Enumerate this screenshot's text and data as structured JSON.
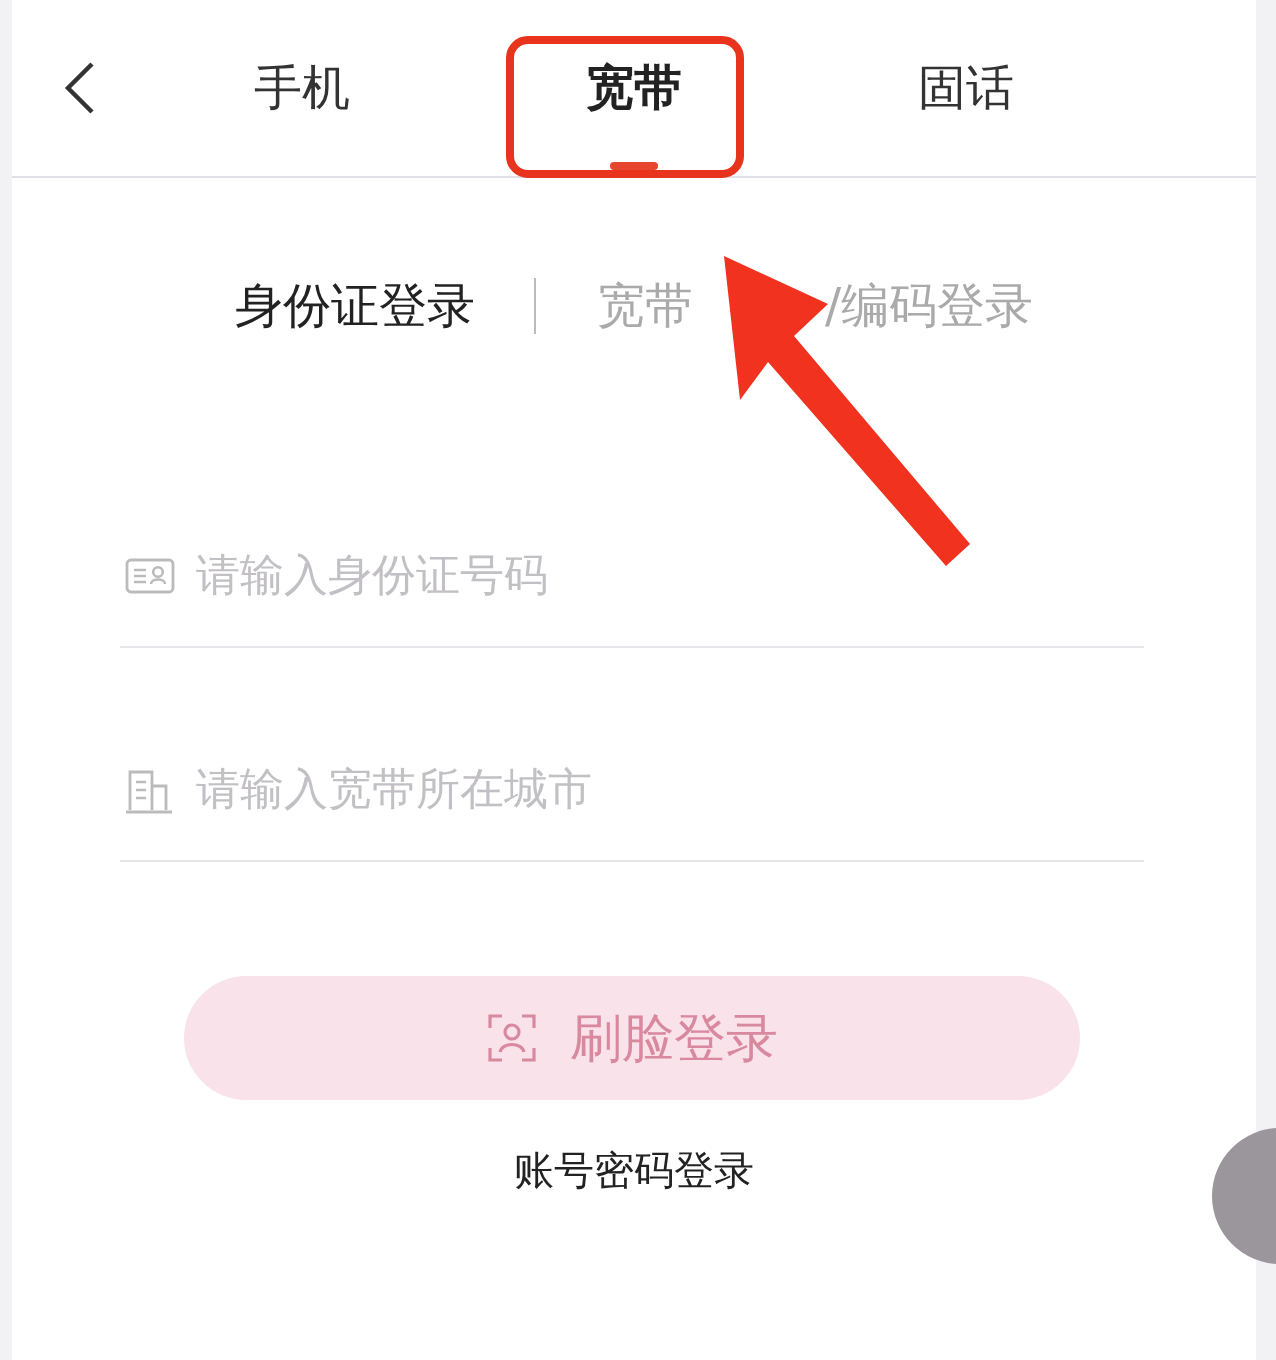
{
  "tabs": [
    {
      "label": "手机",
      "selected": false
    },
    {
      "label": "宽带",
      "selected": true
    },
    {
      "label": "固话",
      "selected": false
    }
  ],
  "login_modes": [
    {
      "label": "身份证登录",
      "selected": true
    },
    {
      "label": "宽带",
      "label_after_arrow": "/编码登录",
      "selected": false
    }
  ],
  "fields": [
    {
      "kind": "id-card",
      "placeholder": "请输入身份证号码"
    },
    {
      "kind": "city",
      "placeholder": "请输入宽带所在城市"
    }
  ],
  "face_login_button": {
    "label": "刷脸登录",
    "disabled": true
  },
  "password_login_link": "账号密码登录",
  "annotations": {
    "highlight_box": true,
    "arrow": true
  }
}
